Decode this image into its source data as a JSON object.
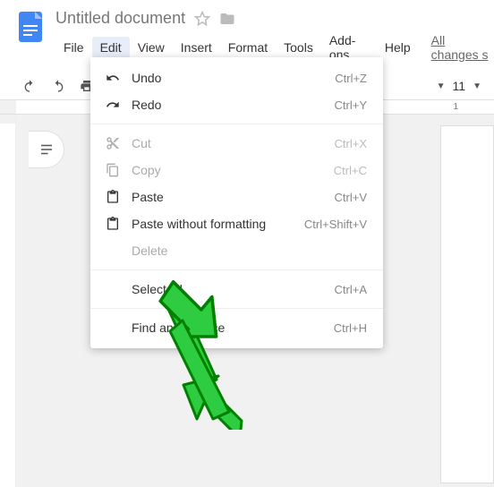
{
  "doc": {
    "title": "Untitled document"
  },
  "menubar": {
    "items": [
      "File",
      "Edit",
      "View",
      "Insert",
      "Format",
      "Tools",
      "Add-ons",
      "Help"
    ],
    "active_index": 1,
    "all_changes": "All changes s"
  },
  "toolbar": {
    "font_size": "11"
  },
  "ruler": {
    "right_mark": "1"
  },
  "edit_menu": {
    "items": [
      {
        "icon": "undo",
        "label": "Undo",
        "shortcut": "Ctrl+Z",
        "enabled": true
      },
      {
        "icon": "redo",
        "label": "Redo",
        "shortcut": "Ctrl+Y",
        "enabled": true
      },
      {
        "sep": true
      },
      {
        "icon": "cut",
        "label": "Cut",
        "shortcut": "Ctrl+X",
        "enabled": false
      },
      {
        "icon": "copy",
        "label": "Copy",
        "shortcut": "Ctrl+C",
        "enabled": false
      },
      {
        "icon": "paste",
        "label": "Paste",
        "shortcut": "Ctrl+V",
        "enabled": true
      },
      {
        "icon": "paste",
        "label": "Paste without formatting",
        "shortcut": "Ctrl+Shift+V",
        "enabled": true
      },
      {
        "icon": "",
        "label": "Delete",
        "shortcut": "",
        "enabled": false
      },
      {
        "sep": true
      },
      {
        "icon": "",
        "label": "Select all",
        "shortcut": "Ctrl+A",
        "enabled": true
      },
      {
        "sep": true
      },
      {
        "icon": "",
        "label": "Find and replace",
        "shortcut": "Ctrl+H",
        "enabled": true
      }
    ]
  }
}
